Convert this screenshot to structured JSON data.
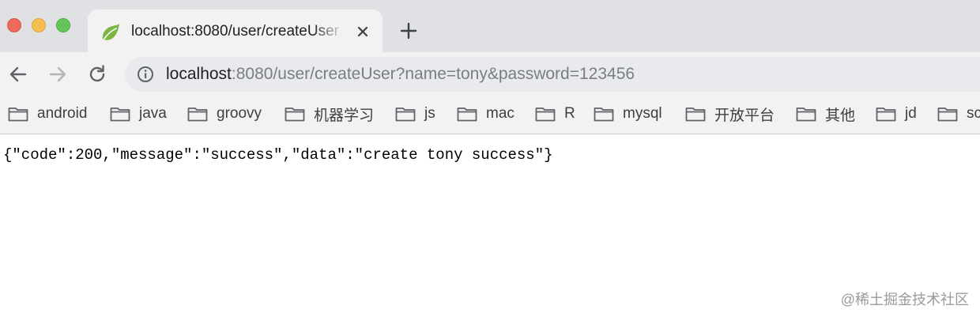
{
  "tab": {
    "title": "localhost:8080/user/createUser",
    "favicon": "spring-leaf-icon"
  },
  "toolbar": {
    "url_host": "localhost",
    "url_rest": ":8080/user/createUser?name=tony&password=123456"
  },
  "bookmarks": [
    {
      "label": "android"
    },
    {
      "label": "java"
    },
    {
      "label": "groovy"
    },
    {
      "label": "机器学习"
    },
    {
      "label": "js"
    },
    {
      "label": "mac"
    },
    {
      "label": "R"
    },
    {
      "label": "mysql"
    },
    {
      "label": "开放平台"
    },
    {
      "label": "其他"
    },
    {
      "label": "jd"
    },
    {
      "label": "sc"
    }
  ],
  "content": {
    "body": "{\"code\":200,\"message\":\"success\",\"data\":\"create tony success\"}"
  },
  "watermark": "@稀土掘金技术社区",
  "colors": {
    "tabstrip": "#dfe1e5",
    "toolbar": "#f2f2f2",
    "traffic_close": "#ee6a5f",
    "traffic_min": "#f5be4f",
    "traffic_max": "#62c554",
    "favicon": "#7bb640"
  }
}
